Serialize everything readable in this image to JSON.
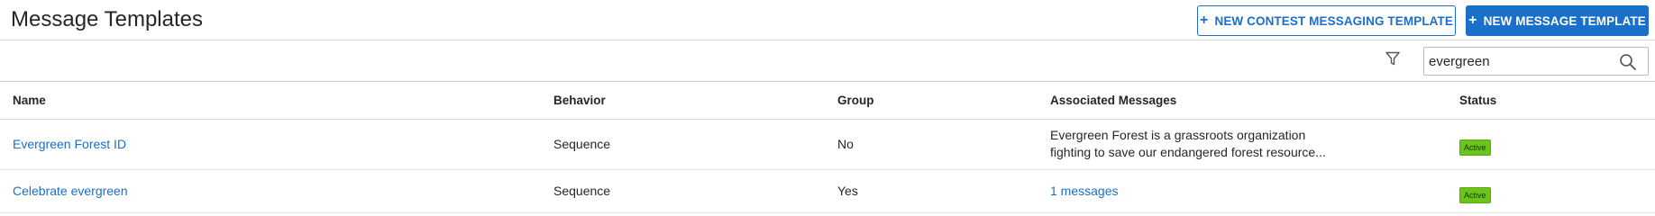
{
  "header": {
    "title": "Message Templates",
    "contest_button": "NEW CONTEST MESSAGING TEMPLATE",
    "new_button": "NEW MESSAGE TEMPLATE",
    "plus_glyph": "+"
  },
  "toolbar": {
    "search_value": "evergreen",
    "icons": {
      "filter": "filter-icon",
      "search": "search-icon"
    }
  },
  "table": {
    "columns": [
      "Name",
      "Behavior",
      "Group",
      "Associated Messages",
      "Status"
    ],
    "rows": [
      {
        "name": "Evergreen Forest ID",
        "behavior": "Sequence",
        "group": "No",
        "associated_line1": "Evergreen Forest is a grassroots organization",
        "associated_line2": "fighting to save our endangered forest resource...",
        "status": "Active"
      },
      {
        "name": "Celebrate evergreen",
        "behavior": "Sequence",
        "group": "Yes",
        "associated_link": "1 messages",
        "status": "Active"
      }
    ]
  },
  "colors": {
    "accent": "#1a6fc9",
    "status_active": "#6cc31c"
  }
}
